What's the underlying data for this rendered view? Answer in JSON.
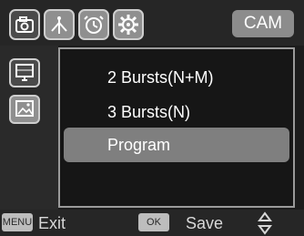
{
  "top_tabs": [
    {
      "icon": "camera-icon",
      "active": true
    },
    {
      "icon": "tower-icon",
      "active": false
    },
    {
      "icon": "alarm-clock-icon",
      "active": false
    },
    {
      "icon": "gear-icon",
      "active": false
    }
  ],
  "mode_badge": "CAM",
  "left_tabs": [
    {
      "icon": "monitor-icon",
      "active": false
    },
    {
      "icon": "image-icon",
      "active": true
    }
  ],
  "menu": {
    "items": [
      {
        "label": "2 Bursts(N+M)",
        "selected": false
      },
      {
        "label": "3 Bursts(N)",
        "selected": false
      },
      {
        "label": "Program",
        "selected": true
      }
    ]
  },
  "footer": {
    "menu_key": "MENU",
    "menu_action": "Exit",
    "ok_key": "OK",
    "ok_action": "Save",
    "updown_icon": "up-down-arrows-icon"
  },
  "colors": {
    "background": "#1c1c1c",
    "selected_row": "#7f7f7f",
    "tab_border": "#cfcfcf"
  }
}
